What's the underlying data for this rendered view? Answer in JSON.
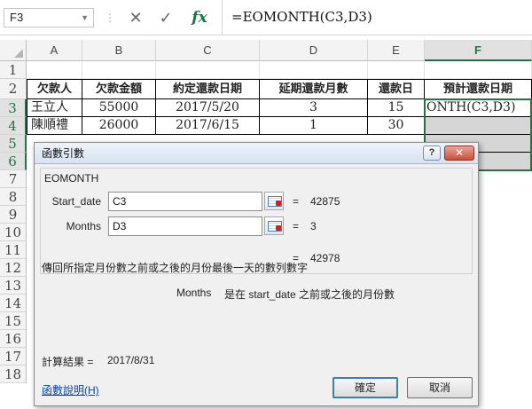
{
  "formula_bar": {
    "name_box": "F3",
    "cancel_icon": "x-icon",
    "enter_icon": "check-icon",
    "fx_label": "fx",
    "formula": "=EOMONTH(C3,D3)"
  },
  "grid": {
    "columns": [
      "A",
      "B",
      "C",
      "D",
      "E",
      "F"
    ],
    "selected_column": "F",
    "rows": [
      "1",
      "2",
      "3",
      "4",
      "5",
      "6",
      "7",
      "8",
      "9",
      "10",
      "11",
      "12",
      "13",
      "14",
      "15",
      "16",
      "17",
      "18"
    ],
    "selected_rows": [
      "3",
      "4",
      "5",
      "6"
    ],
    "headers": [
      "欠款人",
      "欠款金額",
      "約定還款日期",
      "延期還款月數",
      "還款日",
      "預計還款日期"
    ],
    "data_rows": [
      [
        "王立人",
        "55000",
        "2017/5/20",
        "3",
        "15",
        "ONTH(C3,D3)"
      ],
      [
        "陳順禮",
        "26000",
        "2017/6/15",
        "1",
        "30",
        ""
      ]
    ]
  },
  "dialog": {
    "title": "函數引數",
    "help_button": "?",
    "close_button": "✕",
    "function_name": "EOMONTH",
    "args": [
      {
        "label": "Start_date",
        "value": "C3",
        "result": "42875"
      },
      {
        "label": "Months",
        "value": "D3",
        "result": "3"
      }
    ],
    "formula_result": "42978",
    "description": "傳回所指定月份數之前或之後的月份最後一天的數列數字",
    "arg_description_name": "Months",
    "arg_description": "是在 start_date 之前或之後的月份數",
    "calc_result_label": "計算結果 =",
    "calc_result_value": "2017/8/31",
    "help_link": "函數說明(H)",
    "ok_button": "確定",
    "cancel_button": "取消"
  },
  "colors": {
    "accent": "#217346",
    "selection_fill": "#d6d6d6"
  }
}
